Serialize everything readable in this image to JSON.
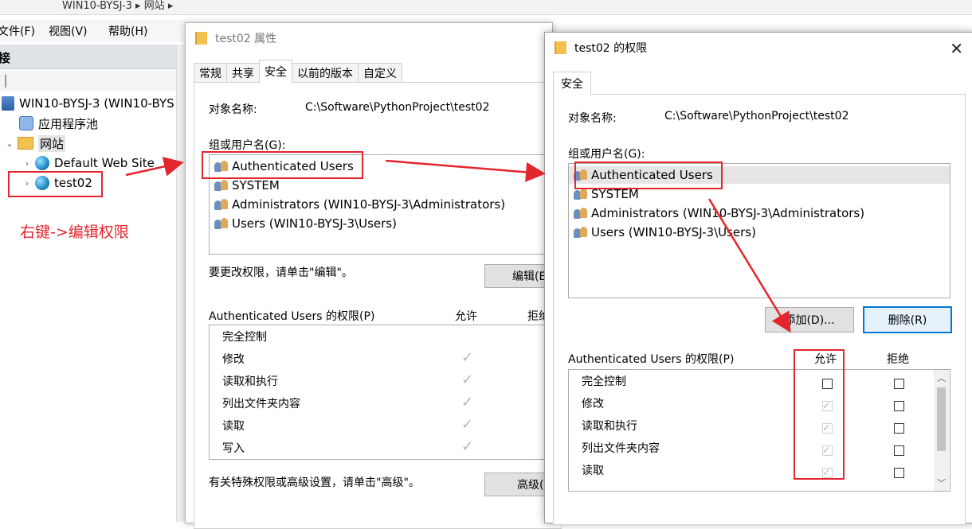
{
  "background": {
    "breadcrumb": "WIN10-BYSJ-3 ▸ 网站 ▸",
    "menu": {
      "file": "文件(F)",
      "view": "视图(V)",
      "help": "帮助(H)"
    },
    "panel_header": "接",
    "tree": {
      "server": "WIN10-BYSJ-3 (WIN10-BYS",
      "app_pools": "应用程序池",
      "sites": "网站",
      "default_site": "Default Web Site",
      "test02": "test02"
    }
  },
  "annotation": {
    "text": "右键->编辑权限",
    "color": "#e3262d"
  },
  "properties_dialog": {
    "title": "test02 属性",
    "tabs": [
      "常规",
      "共享",
      "安全",
      "以前的版本",
      "自定义"
    ],
    "object_label": "对象名称:",
    "object_value": "C:\\Software\\PythonProject\\test02",
    "groups_label": "组或用户名(G):",
    "users": [
      "Authenticated Users",
      "SYSTEM",
      "Administrators (WIN10-BYSJ-3\\Administrators)",
      "Users (WIN10-BYSJ-3\\Users)"
    ],
    "edit_hint": "要更改权限，请单击\"编辑\"。",
    "edit_button": "编辑(E",
    "perm_label": "Authenticated Users 的权限(P)",
    "allow_header": "允许",
    "deny_header": "拒绝",
    "permissions": [
      "完全控制",
      "修改",
      "读取和执行",
      "列出文件夹内容",
      "读取",
      "写入"
    ],
    "advanced_hint": "有关特殊权限或高级设置，请单击\"高级\"。",
    "advanced_button": "高级("
  },
  "permissions_dialog": {
    "title": "test02 的权限",
    "tab": "安全",
    "object_label": "对象名称:",
    "object_value": "C:\\Software\\PythonProject\\test02",
    "groups_label": "组或用户名(G):",
    "users": [
      "Authenticated Users",
      "SYSTEM",
      "Administrators (WIN10-BYSJ-3\\Administrators)",
      "Users (WIN10-BYSJ-3\\Users)"
    ],
    "add_button": "添加(D)...",
    "remove_button": "删除(R)",
    "perm_label": "Authenticated Users 的权限(P)",
    "allow_header": "允许",
    "deny_header": "拒绝",
    "permissions": [
      "完全控制",
      "修改",
      "读取和执行",
      "列出文件夹内容",
      "读取"
    ]
  }
}
